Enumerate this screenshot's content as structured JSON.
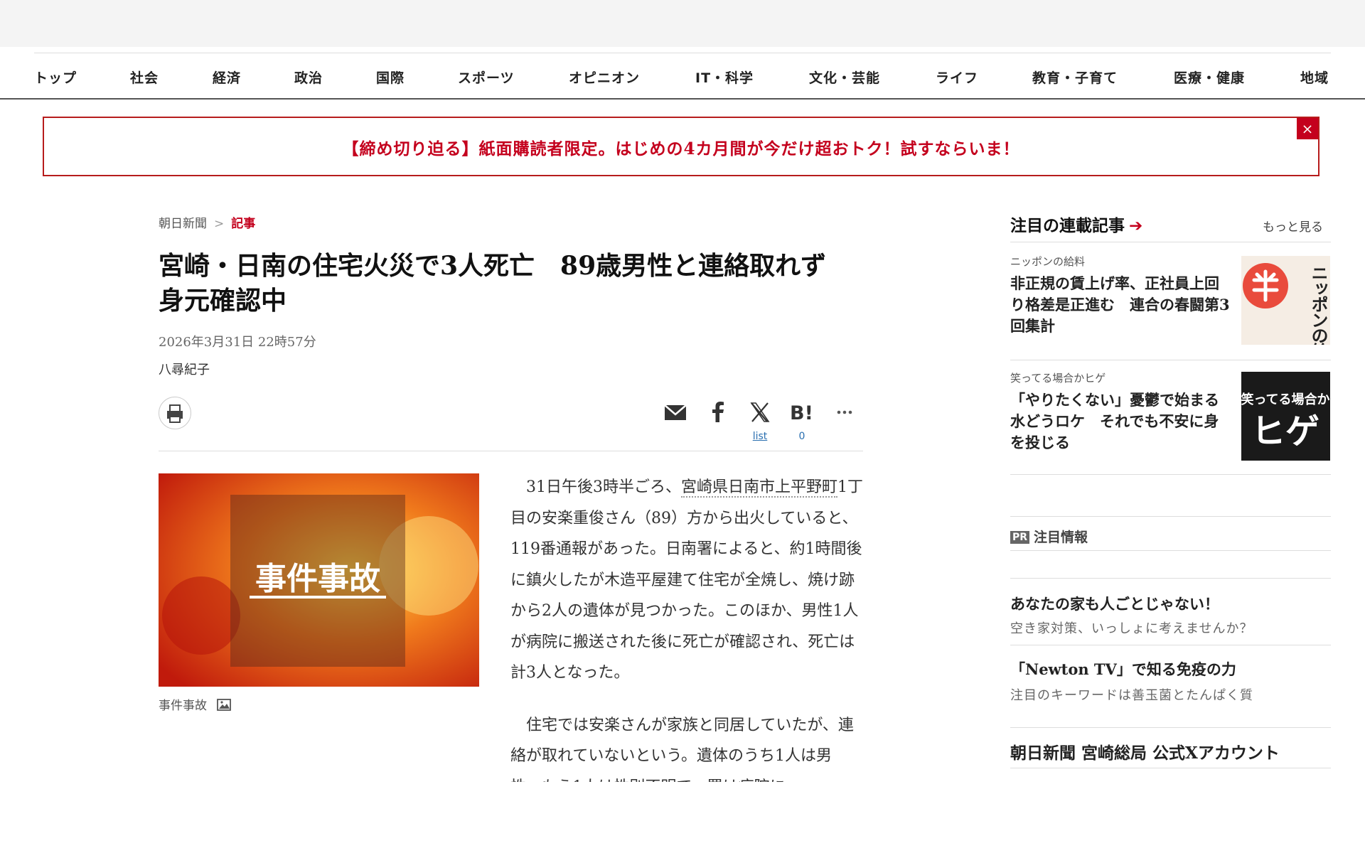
{
  "nav": {
    "items": [
      {
        "label": "トップ"
      },
      {
        "label": "社会"
      },
      {
        "label": "経済"
      },
      {
        "label": "政治"
      },
      {
        "label": "国際"
      },
      {
        "label": "スポーツ"
      },
      {
        "label": "オピニオン"
      },
      {
        "label": "IT・科学"
      },
      {
        "label": "文化・芸能"
      },
      {
        "label": "ライフ"
      },
      {
        "label": "教育・子育て"
      },
      {
        "label": "医療・健康"
      },
      {
        "label": "地域"
      }
    ]
  },
  "promo": {
    "text": "【締め切り迫る】紙面購読者限定。はじめの4カ月間が今だけ超おトク！試すならいま！",
    "close_label": "×"
  },
  "breadcrumb": {
    "home": "朝日新聞",
    "separator": ">",
    "current": "記事"
  },
  "article": {
    "headline_line1": "宮崎・日南の住宅火災で3人死亡　89歳男性と連絡取れず",
    "headline_line2": "身元確認中",
    "date": "2026年3月31日 22時57分",
    "author": "八尋紀子",
    "share": {
      "x_link_label": "list",
      "hatena_count": "0"
    },
    "photo_overlay_text": "事件事故",
    "caption": "事件事故",
    "paragraph1_pre": "31日午後3時半ごろ、",
    "paragraph1_place": "宮崎県日南市上平野町",
    "paragraph1_post": "1丁目の安楽重俊さん（89）方から出火していると、119番通報があった。日南署によると、約1時間後に鎮火したが木造平屋建て住宅が全焼し、焼け跡から2人の遺体が見つかった。このほか、男性1人が病院に搬送された後に死亡が確認され、死亡は計3人となった。",
    "paragraph2": "住宅では安楽さんが家族と同居していたが、連絡が取れていないという。遺体のうち1人は男性、もう1人は性別不明で、署は病院に"
  },
  "sidebar": {
    "title": "注目の連載記事",
    "title_arrow": "➔",
    "more_link": "もっと見る",
    "items": [
      {
        "category": "ニッポンの給料",
        "title": "非正規の賃上げ率、正社員上回り格差是正進む　連合の春闘第3回集計",
        "thumb_text": "ニッポンの給料",
        "thumb_color": "#e94b3c"
      },
      {
        "category": "笑ってる場合かヒゲ",
        "title": "「やりたくない」憂鬱で始まる水どうロケ　それでも不安に身を投じる",
        "thumb_text_small": "笑ってる場合か",
        "thumb_text_big": "ヒゲ",
        "thumb_color": "#1a1a1a"
      }
    ]
  },
  "pr": {
    "badge": "PR",
    "title": "注目情報",
    "items": [
      {
        "title": "あなたの家も人ごとじゃない！",
        "subtitle": "空き家対策、いっしょに考えませんか？"
      },
      {
        "title": "「Newton TV」で知る免疫の力",
        "subtitle": "注目のキーワードは善玉菌とたんぱく質"
      },
      {
        "title": "朝日新聞 宮崎総局 公式Xアカウント",
        "subtitle": ""
      }
    ]
  },
  "colors": {
    "accent_red": "#c4001d",
    "link_blue": "#2a6fb0"
  }
}
